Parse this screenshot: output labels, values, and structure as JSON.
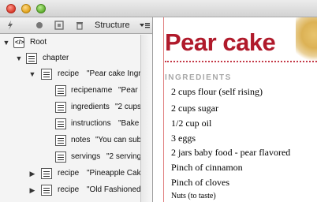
{
  "window": {
    "controls": [
      "close",
      "minimize",
      "zoom"
    ]
  },
  "structure_panel": {
    "toolbar": {
      "label": "Structure",
      "icons": [
        "lightning-icon",
        "circle-icon",
        "frame-icon",
        "trash-icon"
      ],
      "menu_icon": "panel-menu-icon"
    },
    "tree": [
      {
        "label": "Root",
        "expanded": true,
        "icon": "xml-root-icon"
      },
      {
        "label": "chapter",
        "expanded": true,
        "icon": "element-icon"
      },
      {
        "label": "recipe",
        "value": "\"Pear cake Ingre",
        "expanded": true,
        "icon": "element-icon"
      },
      {
        "label": "recipename",
        "value": "\"Pear c",
        "icon": "element-icon"
      },
      {
        "label": "ingredients",
        "value": "\"2 cups",
        "icon": "element-icon"
      },
      {
        "label": "instructions",
        "value": "\"Bake i",
        "icon": "element-icon"
      },
      {
        "label": "notes",
        "value": "\"You can sub",
        "icon": "element-icon"
      },
      {
        "label": "servings",
        "value": "\"2 serving",
        "icon": "element-icon"
      },
      {
        "label": "recipe",
        "value": "\"Pineapple Cake",
        "expanded": false,
        "icon": "element-icon"
      },
      {
        "label": "recipe",
        "value": "\"Old Fashioned (",
        "expanded": false,
        "icon": "element-icon"
      }
    ]
  },
  "document": {
    "title": "Pear cake",
    "section_heading": "INGREDIENTS",
    "ingredients": [
      "2 cups flour (self rising)",
      "2 cups sugar",
      "1/2 cup oil",
      "3 eggs",
      "2 jars baby food - pear flavored",
      "Pinch of cinnamon",
      "Pinch of cloves",
      "Nuts (to taste)"
    ],
    "colors": {
      "title": "#b01a2b",
      "section": "#a8a8a8",
      "rule": "#c43a48"
    }
  }
}
